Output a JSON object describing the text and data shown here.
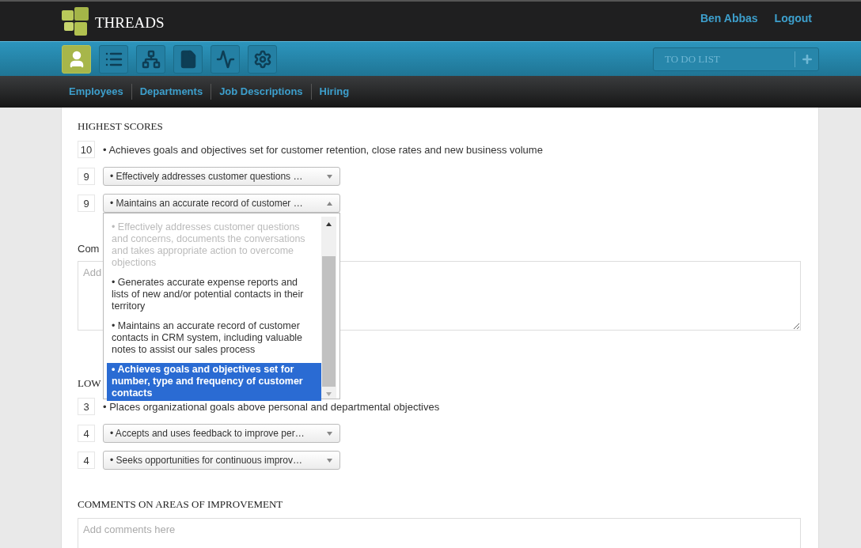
{
  "header": {
    "logo_text": "THREADS",
    "user": "Ben Abbas",
    "logout": "Logout"
  },
  "toolbar": {
    "icons": [
      {
        "kind": "person",
        "selected": true
      },
      {
        "kind": "list",
        "selected": false
      },
      {
        "kind": "org",
        "selected": false
      },
      {
        "kind": "document",
        "selected": false
      },
      {
        "kind": "chart",
        "selected": false
      },
      {
        "kind": "gear",
        "selected": false
      }
    ],
    "todo": {
      "placeholder": "TO DO LIST"
    }
  },
  "subnav": [
    "Employees",
    "Departments",
    "Job Descriptions",
    "Hiring"
  ],
  "highest": {
    "heading": "HIGHEST SCORES",
    "rows": [
      {
        "score": "10",
        "kind": "text",
        "text": "• Achieves goals and objectives set for customer retention, close rates and new business volume"
      },
      {
        "score": "9",
        "kind": "select",
        "text": "• Effectively addresses customer questions …",
        "expanded": false
      },
      {
        "score": "9",
        "kind": "select",
        "text": "• Maintains an accurate record of customer …",
        "expanded": true,
        "options": [
          {
            "text": "• Effectively addresses customer questions and concerns, documents the conversations and takes appropriate action to overcome objections",
            "selected": false,
            "disabled": true
          },
          {
            "text": "• Generates accurate expense reports and lists of new and/or potential contacts in their territory",
            "selected": false,
            "disabled": false
          },
          {
            "text": "• Maintains an accurate record of customer contacts in CRM system, including valuable notes to assist our sales process",
            "selected": false,
            "disabled": false
          },
          {
            "text": "• Achieves goals and objectives set for number, type and frequency of customer contacts",
            "selected": true,
            "disabled": false
          }
        ]
      }
    ],
    "comments_label": "Com",
    "comments_placeholder": "Add"
  },
  "lowest": {
    "heading": "LOW",
    "rows": [
      {
        "score": "3",
        "kind": "text",
        "text": "• Places organizational goals above personal and departmental objectives"
      },
      {
        "score": "4",
        "kind": "select",
        "text": "• Accepts and uses feedback to improve per…",
        "expanded": false
      },
      {
        "score": "4",
        "kind": "select",
        "text": "• Seeks opportunities for continuous improv…",
        "expanded": false
      }
    ]
  },
  "improvement": {
    "heading": "COMMENTS ON AREAS OF IMPROVEMENT",
    "placeholder": "Add comments here"
  }
}
